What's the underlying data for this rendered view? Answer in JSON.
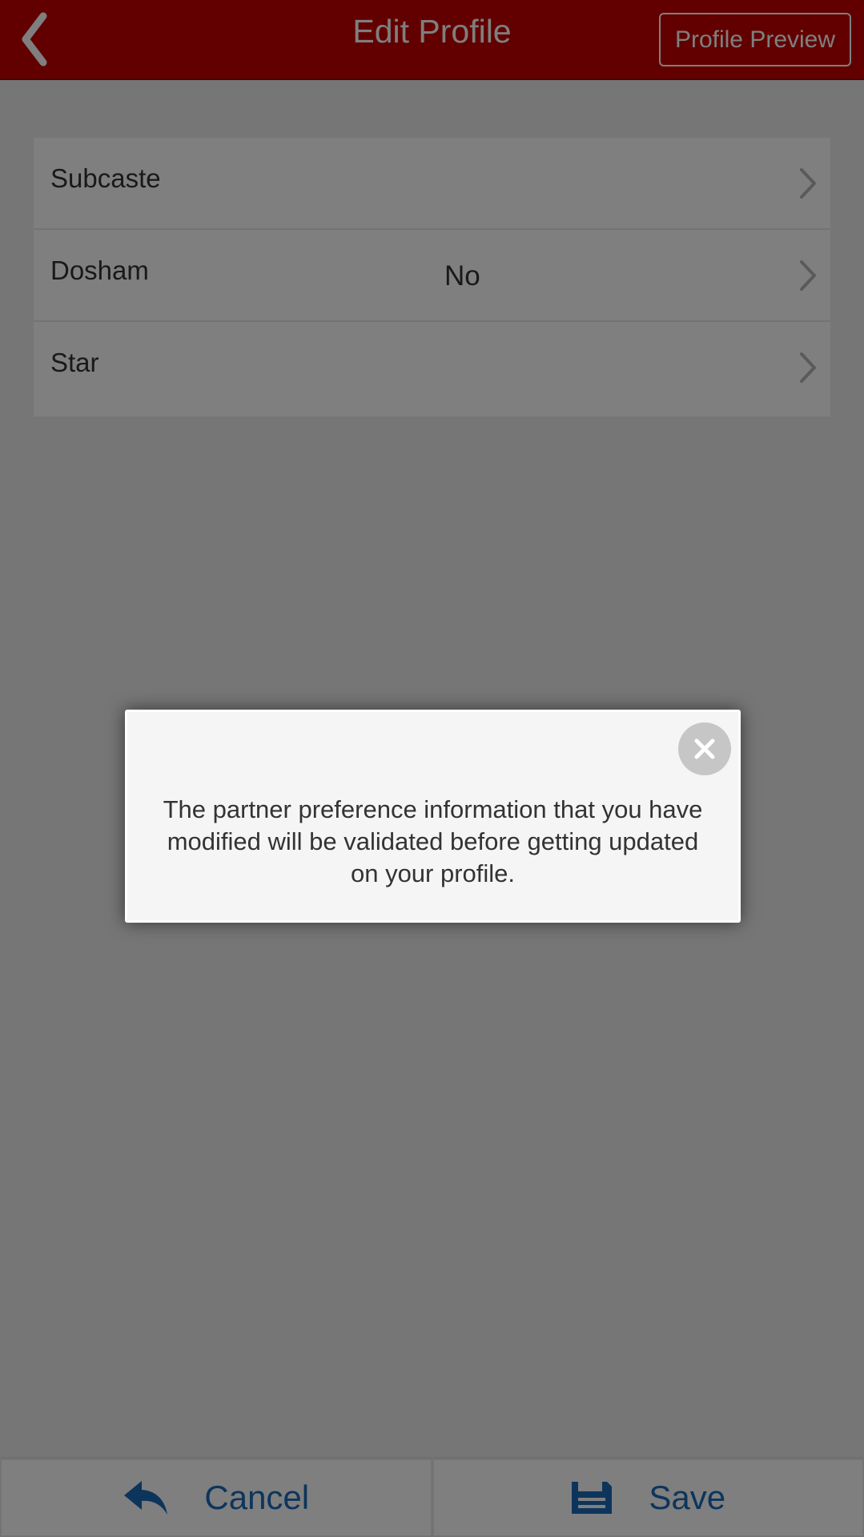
{
  "header": {
    "title": "Edit Profile",
    "preview_button": "Profile Preview",
    "back_icon": "chevron-left-icon",
    "color": "#c40000"
  },
  "list": {
    "items": [
      {
        "label": "Subcaste",
        "value": ""
      },
      {
        "label": "Dosham",
        "value": "No"
      },
      {
        "label": "Star",
        "value": ""
      }
    ]
  },
  "bottom_bar": {
    "cancel_label": "Cancel",
    "cancel_icon": "reply-arrow-icon",
    "save_label": "Save",
    "save_icon": "floppy-disk-icon",
    "accent_color": "#1a6ab8"
  },
  "dialog": {
    "message": "The partner preference information that you have modified will be validated before getting updated on your profile.",
    "close_icon": "close-icon"
  }
}
